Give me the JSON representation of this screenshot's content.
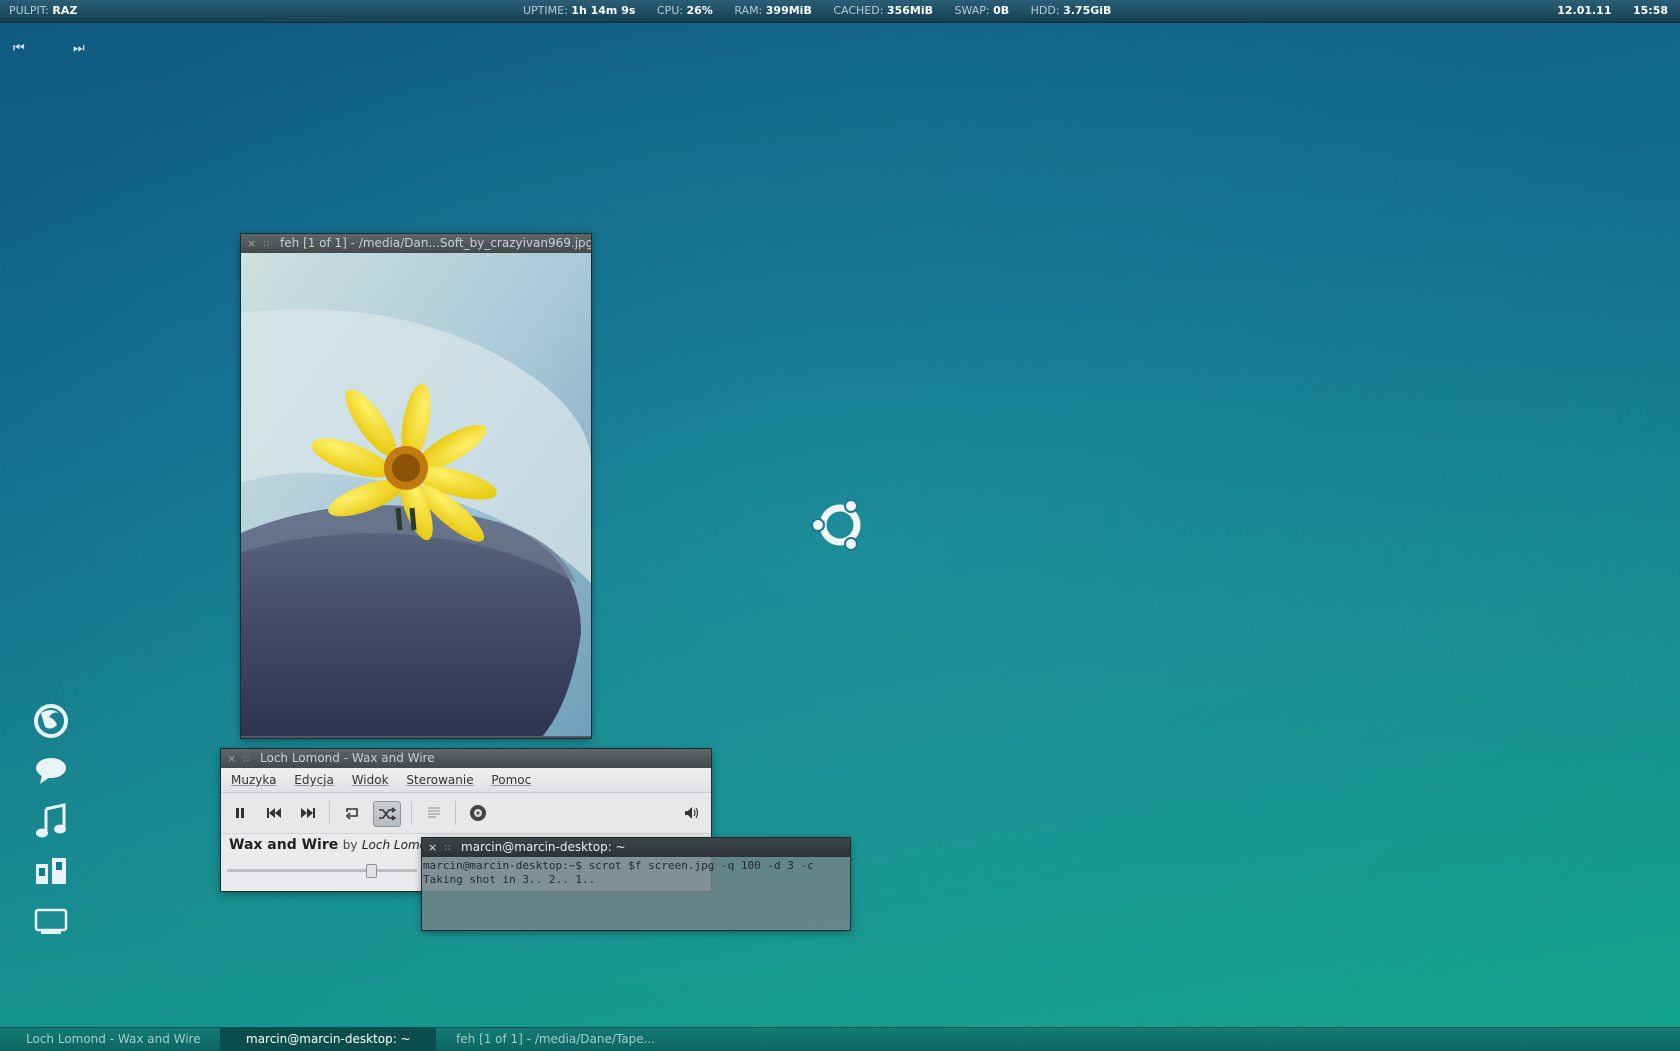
{
  "topbar": {
    "pulpit_key": "PULPIT:",
    "pulpit_val": "RAZ",
    "stats": [
      {
        "k": "UPTIME:",
        "v": "1h 14m 9s"
      },
      {
        "k": "CPU:",
        "v": "26%"
      },
      {
        "k": "RAM:",
        "v": "399MiB"
      },
      {
        "k": "CACHED:",
        "v": "356MiB"
      },
      {
        "k": "SWAP:",
        "v": "0B"
      },
      {
        "k": "HDD:",
        "v": "3.75GiB"
      }
    ],
    "date": "12.01.11",
    "time": "15:58"
  },
  "media": {
    "prev": "⏮",
    "next": "⏭"
  },
  "dock": {
    "icons": [
      "firefox-icon",
      "chat-icon",
      "music-icon",
      "files-icon",
      "screen-icon"
    ]
  },
  "feh_window": {
    "close": "×",
    "grip": "::",
    "title": "feh [1 of 1] - /media/Dan...Soft_by_crazyivan969.jpg"
  },
  "player_window": {
    "close": "×",
    "grip": "::",
    "title": "Loch Lomond - Wax and Wire",
    "menu": [
      "Muzyka",
      "Edycja",
      "Widok",
      "Sterowanie",
      "Pomoc"
    ],
    "track": "Wax and Wire",
    "by": "by",
    "artist": "Loch Lomond",
    "position": 0.76
  },
  "terminal_window": {
    "close": "×",
    "grip": "::",
    "title": "marcin@marcin-desktop: ~",
    "lines": [
      "marcin@marcin-desktop:~$ scrot $f screen.jpg -q 100 -d 3 -c",
      "Taking shot in 3.. 2.. 1.."
    ]
  },
  "taskbar": {
    "tasks": [
      {
        "label": "Loch Lomond - Wax and Wire"
      },
      {
        "label": "marcin@marcin-desktop: ~"
      },
      {
        "label": "feh [1 of 1] - /media/Dane/Tape..."
      }
    ]
  }
}
